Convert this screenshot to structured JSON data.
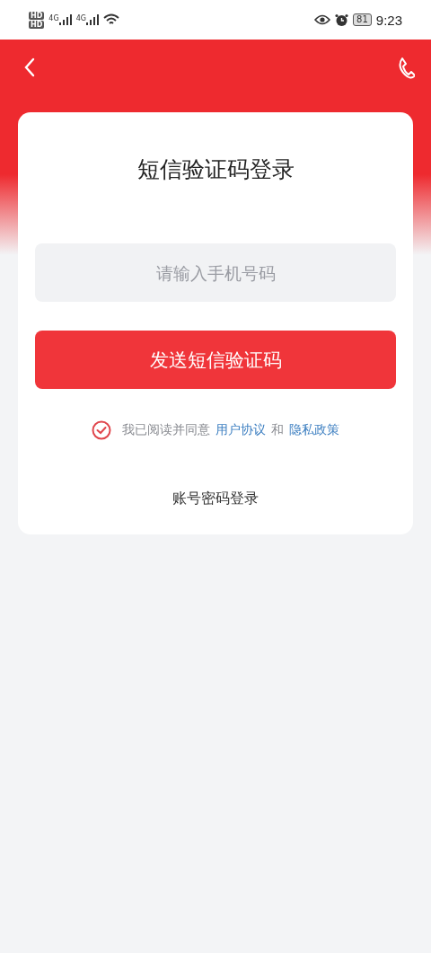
{
  "status_bar": {
    "sims": [
      {
        "hd": "HD",
        "network": "4G"
      },
      {
        "hd": "HD",
        "network": "4G"
      }
    ],
    "battery": "81",
    "time": "9:23"
  },
  "login": {
    "title": "短信验证码登录",
    "phone_field": {
      "placeholder": "请输入手机号码"
    },
    "send_button": "发送短信验证码",
    "agreement": {
      "checked": true,
      "parts": [
        {
          "kind": "text",
          "text": "我已阅读并同意"
        },
        {
          "kind": "link",
          "text": "用户协议"
        },
        {
          "kind": "text",
          "text": "和"
        },
        {
          "kind": "link",
          "text": "隐私政策"
        }
      ]
    },
    "alt_login": "账号密码登录"
  }
}
